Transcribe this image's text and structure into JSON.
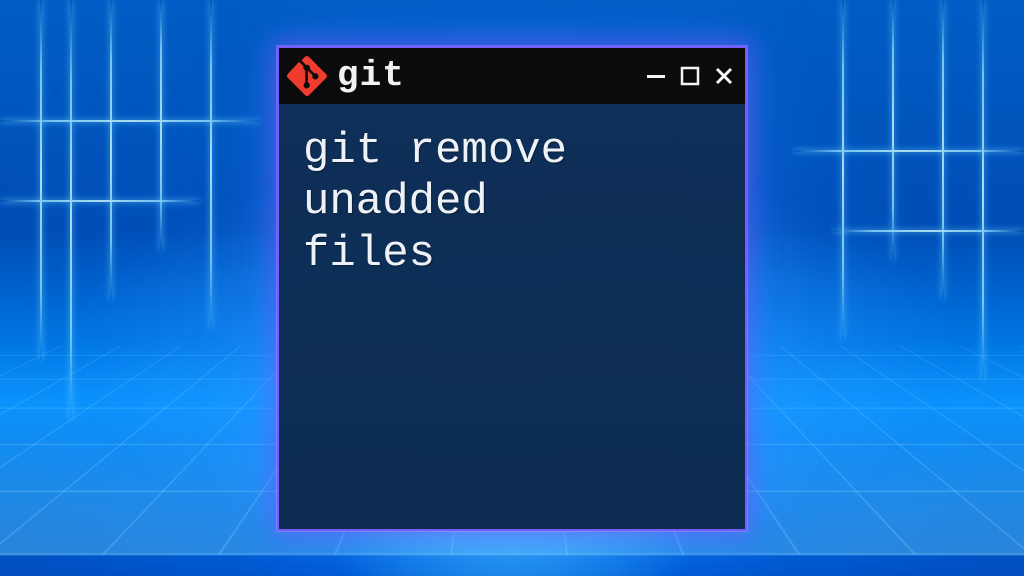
{
  "window": {
    "title": "git",
    "logo_name": "git-logo-icon",
    "controls": {
      "minimize_name": "minimize-icon",
      "maximize_name": "maximize-icon",
      "close_name": "close-icon"
    }
  },
  "terminal": {
    "content": "git remove\nunadded\nfiles"
  },
  "colors": {
    "window_border": "#7a59ff",
    "terminal_bg": "#0e2f58",
    "titlebar_bg": "#0b0b0b",
    "text": "#eef2f6",
    "git_logo": "#f03c2e"
  }
}
